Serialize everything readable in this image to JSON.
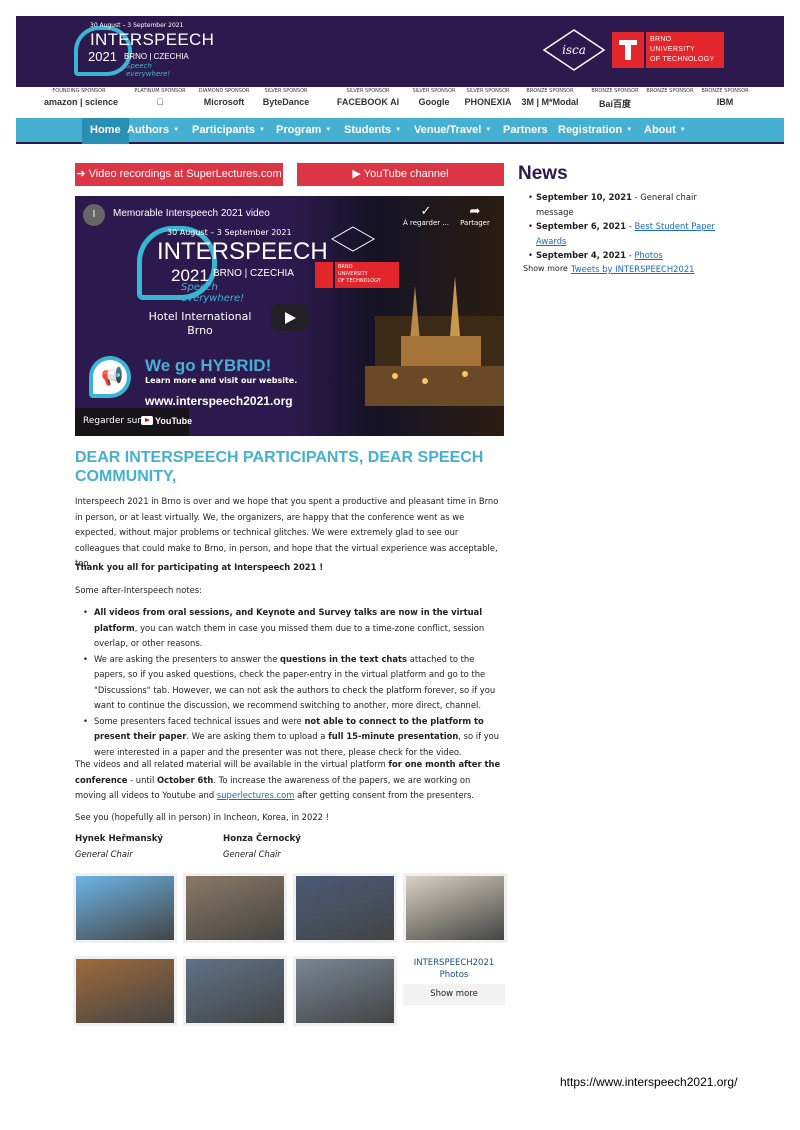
{
  "header": {
    "logo": {
      "dates": "30 August – 3 September 2021",
      "name": "INTERSPEECH",
      "year": "2021",
      "city": "BRNO | CZECHIA",
      "tagline": "Speech everywhere!"
    },
    "isca_logo_text": "isca",
    "university": {
      "line1": "BRNO",
      "line2": "UNIVERSITY",
      "line3": "OF TECHNOLOGY"
    }
  },
  "sponsors": [
    {
      "type": "FOUNDING SPONSOR",
      "name": "amazon | science"
    },
    {
      "type": "PLATINUM SPONSOR",
      "name": ""
    },
    {
      "type": "DIAMOND SPONSOR",
      "name": "Microsoft"
    },
    {
      "type": "SILVER SPONSOR",
      "name": "ByteDance"
    },
    {
      "type": "SILVER SPONSOR",
      "name": "FACEBOOK AI"
    },
    {
      "type": "SILVER SPONSOR",
      "name": "Google"
    },
    {
      "type": "SILVER SPONSOR",
      "name": "PHONEXIA"
    },
    {
      "type": "BRONZE SPONSOR",
      "name": "3M | M*Modal"
    },
    {
      "type": "BRONZE SPONSOR",
      "name": "Bai百度"
    },
    {
      "type": "BRONZE SPONSOR",
      "name": ""
    },
    {
      "type": "BRONZE SPONSOR",
      "name": "IBM"
    }
  ],
  "nav": {
    "items": [
      {
        "label": "Home",
        "dropdown": false
      },
      {
        "label": "Authors",
        "dropdown": true
      },
      {
        "label": "Participants",
        "dropdown": true
      },
      {
        "label": "Program",
        "dropdown": true
      },
      {
        "label": "Students",
        "dropdown": true
      },
      {
        "label": "Venue/Travel",
        "dropdown": true
      },
      {
        "label": "Partners",
        "dropdown": false
      },
      {
        "label": "Registration",
        "dropdown": true
      },
      {
        "label": "About",
        "dropdown": true
      }
    ],
    "caret": "▼"
  },
  "buttons": {
    "video_recordings": "Video recordings at SuperLectures.com",
    "youtube": "YouTube channel"
  },
  "video": {
    "avatar_letter": "I",
    "title": "Memorable Interspeech 2021 video",
    "watch_later": "À regarder ...",
    "share": "Partager",
    "hotel": "Hotel International Brno",
    "hybrid": "We go HYBRID!",
    "hybrid_sub": "Learn more and visit our website.",
    "url": "www.interspeech2021.org",
    "watch_on": "Regarder sur",
    "youtube": "YouTube"
  },
  "main": {
    "heading": "DEAR INTERSPEECH PARTICIPANTS, DEAR SPEECH COMMUNITY,",
    "intro": "Interspeech 2021 in Brno is over and we hope that you spent a productive and pleasant time in Brno in person, or at least virtually. We, the organizers, are happy that the conference went as we expected, without major problems or technical glitches. We were extremely glad to see our colleagues that could make to Brno, in person, and hope that the virtual experience was acceptable, too.",
    "thanks": "Thank you all for participating at Interspeech 2021 !",
    "notes_intro": "Some after-Interspeech notes:",
    "bullet1_bold": "All videos from oral sessions, and Keynote and Survey talks are now in the virtual platform",
    "bullet1_rest": ", you can watch them in case you missed them due to a time-zone conflict, session overlap, or other reasons.",
    "bullet2_a": "We are asking the presenters to answer the ",
    "bullet2_bold": "questions in the text chats",
    "bullet2_b": " attached to the papers, so if you asked questions, check the paper-entry in the virtual platform and go to the \"Discussions\" tab. However, we can not ask the authors to check the platform forever, so if you want to continue the discussion, we recommend switching to another, more direct, channel.",
    "bullet3_a": "Some presenters faced technical issues and were ",
    "bullet3_bold1": "not able to connect to the platform to present their paper",
    "bullet3_b": ". We are asking them to upload a ",
    "bullet3_bold2": "full 15-minute presentation",
    "bullet3_c": ", so if you were interested in a paper and the presenter was not there, please check for the video.",
    "avail_a": "The videos and all related material will be available in the virtual platform ",
    "avail_bold1": "for one month after the conference",
    "avail_b": " - until ",
    "avail_bold2": "October 6th",
    "avail_c": ". To increase the awareness of the papers, we are working on moving all videos to Youtube and ",
    "avail_link": "superlectures.com",
    "avail_d": " after getting consent from the presenters.",
    "see_you": "See you (hopefully all in person) in Incheon, Korea, in 2022 !",
    "signers": [
      {
        "name": "Hynek Heřmanský",
        "role": "General Chair"
      },
      {
        "name": "Honza Černocký",
        "role": "General Chair"
      }
    ]
  },
  "photos": {
    "title": "INTERSPEECH2021 Photos",
    "show_more": "Show more",
    "tiles": [
      "#6cb4e6",
      "#8a7a64",
      "#4b5a78",
      "#d9d2c4",
      "#9e6a3c",
      "#5f7288",
      "#7a8694"
    ]
  },
  "news": {
    "title": "News",
    "items": [
      {
        "date": "September 10, 2021",
        "sep": " - ",
        "text": "General chair message",
        "link": false
      },
      {
        "date": "September 6, 2021",
        "sep": " - ",
        "text": "Best Student Paper Awards",
        "link": true
      },
      {
        "date": "September 4, 2021",
        "sep": " - ",
        "text": "Photos",
        "link": true
      }
    ],
    "show_more": "Show more",
    "tweets": "Tweets by INTERSPEECH2021"
  },
  "footer_url": "https://www.interspeech2021.org/",
  "colors": {
    "header_bg": "#2c1a4e",
    "nav_bg": "#45b0d2",
    "accent_red": "#dc3545",
    "heading_blue": "#45b0d2"
  }
}
